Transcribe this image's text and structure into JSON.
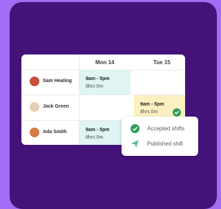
{
  "colors": {
    "background": "#a26cf4",
    "panel": "#44137a",
    "shift_mint": "#dff4f3",
    "shift_yellow": "#fbf0bf",
    "success": "#2f9e5b",
    "published": "#5fb8a8"
  },
  "schedule": {
    "days": [
      "Mon 14",
      "Tue 15"
    ],
    "employees": [
      {
        "name": "Sam Healing",
        "avatar_color": "#c8503a"
      },
      {
        "name": "Jack Green",
        "avatar_color": "#e6cdb6"
      },
      {
        "name": "Ada Smith",
        "avatar_color": "#d97a4a"
      }
    ],
    "shifts": [
      {
        "time": "9am - 5pm",
        "hours": "8hrs 0m"
      },
      {
        "time": "9am - 5pm",
        "hours": "8hrs 0m"
      },
      {
        "time": "9am - 5pm",
        "hours": "8hrs 0m"
      }
    ]
  },
  "legend": {
    "accepted_label": "Accepted shifts",
    "accepted_icon": "check-circle-icon",
    "published_label": "Published shift",
    "published_icon": "send-icon"
  }
}
